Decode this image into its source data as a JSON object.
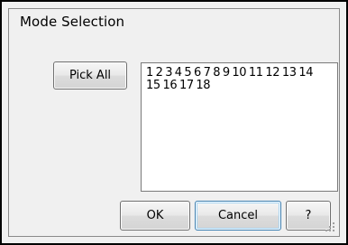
{
  "dialog": {
    "title": "Mode Selection"
  },
  "buttons": {
    "pick_all": "Pick All",
    "ok": "OK",
    "cancel": "Cancel",
    "help": "?"
  },
  "modes_list": {
    "line1": "1 2 3 4 5 6 7 8 9 10 11 12 13 14",
    "line2": "15 16 17 18"
  },
  "icons": {
    "resize_grip": "resize-grip-icon"
  }
}
